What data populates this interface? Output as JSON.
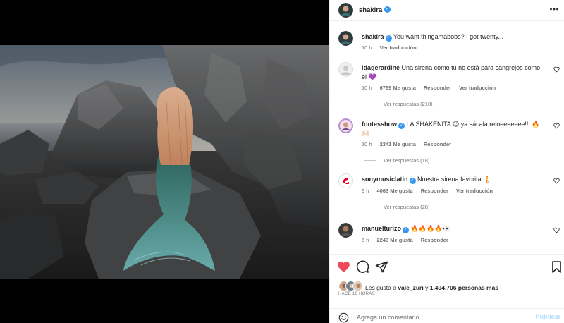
{
  "post": {
    "author": "shakira",
    "verified_mark": "✓",
    "more_icon": "more-horizontal-icon"
  },
  "caption": {
    "username": "shakira",
    "text": "You want thingamabobs? I got twenty...",
    "time": "10 h",
    "translate": "Ver traducción"
  },
  "comments": [
    {
      "username": "idagerardine",
      "verified": false,
      "text": "Una sirena como tú no está para cangrejos como él 💜",
      "time": "10 h",
      "likes": "6799 Me gusta",
      "reply": "Responder",
      "translate": "Ver traducción",
      "replies": "Ver respuestas (210)"
    },
    {
      "username": "fontesshow",
      "verified": true,
      "text": "LA SHAKENITA 😍 ya sácala reineeeeeee!!! 🔥🙌🏻",
      "time": "10 h",
      "likes": "2341 Me gusta",
      "reply": "Responder",
      "replies": "Ver respuestas (18)"
    },
    {
      "username": "sonymusiclatin",
      "verified": true,
      "text": "Nuestra sirena favorita 🧜",
      "time": "9 h",
      "likes": "4063 Me gusta",
      "reply": "Responder",
      "translate": "Ver traducción",
      "replies": "Ver respuestas (28)"
    },
    {
      "username": "manuelturizo",
      "verified": true,
      "text": "🔥🔥🔥🔥👀",
      "time": "6 h",
      "likes": "2243 Me gusta",
      "reply": "Responder"
    }
  ],
  "likes": {
    "prefix": "Les gusta a",
    "user": "vale_zuri",
    "middle": "y",
    "count": "1.494.706 personas más"
  },
  "timestamp": "HACE 10 HORAS",
  "composer": {
    "placeholder": "Agrega un comentario...",
    "publish": "Publicar"
  },
  "colors": {
    "like_red": "#ed4956",
    "verified_blue": "#3797f0",
    "publish_disabled": "#b2dffc",
    "muted": "#737373"
  },
  "icons": [
    "heart-filled-icon",
    "comment-icon",
    "share-icon",
    "bookmark-icon",
    "emoji-icon",
    "heart-outline-icon"
  ]
}
